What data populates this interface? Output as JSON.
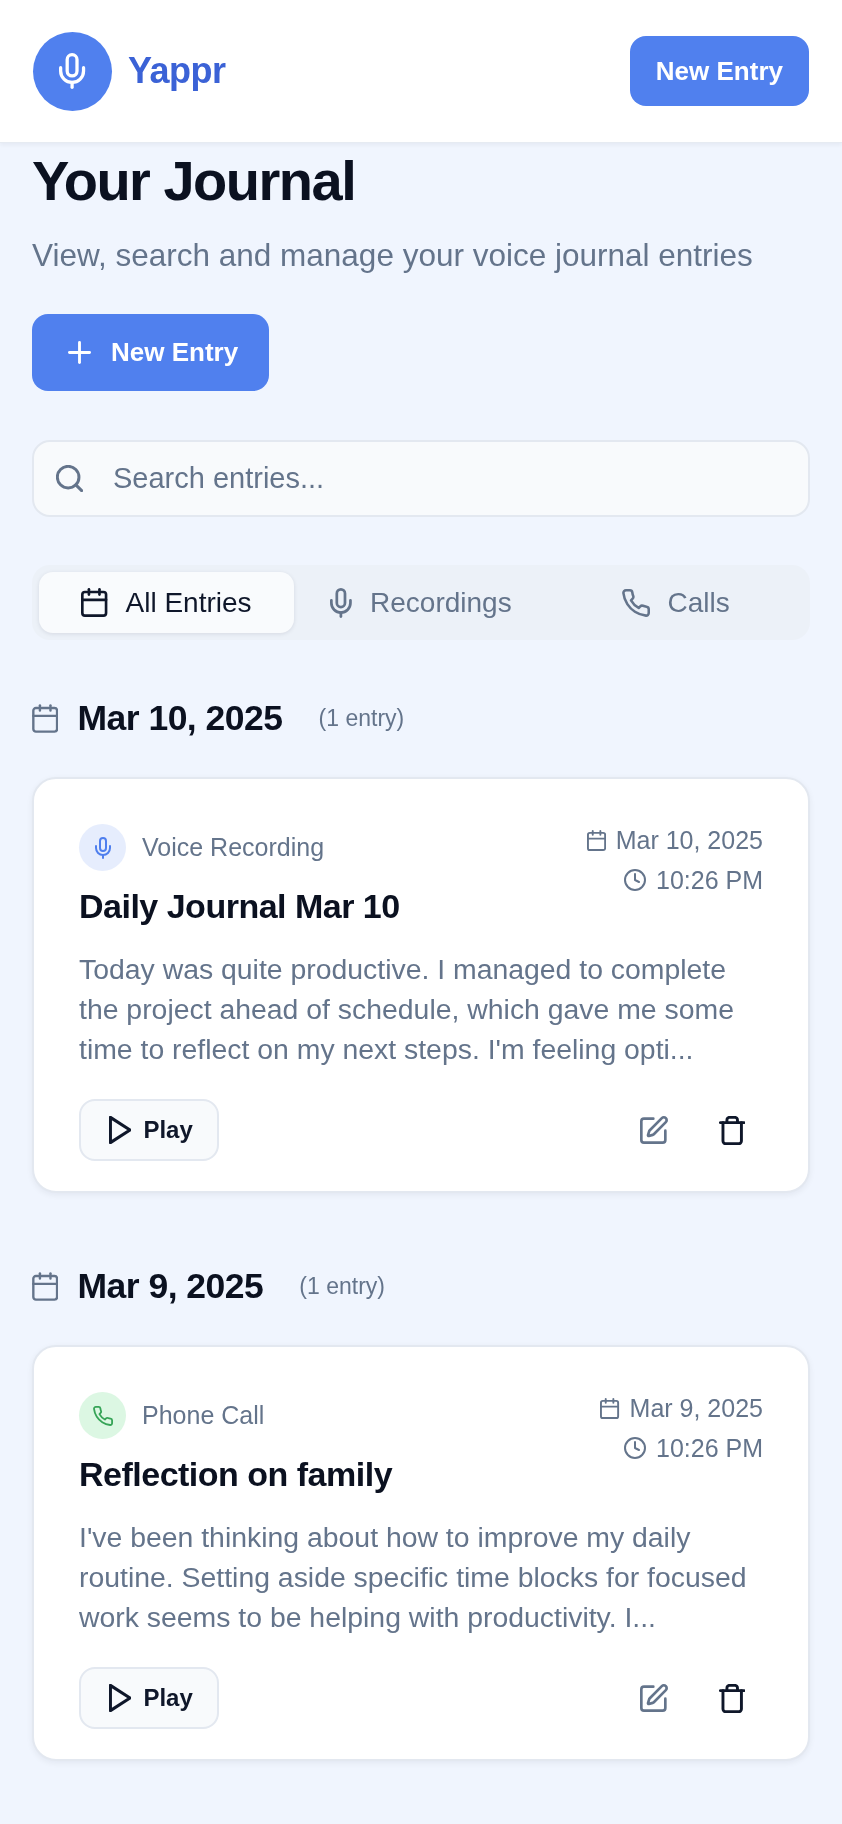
{
  "header": {
    "app_name": "Yappr",
    "button": "New Entry"
  },
  "intro": {
    "title": "Your Journal",
    "subtitle": "View, search and manage your voice journal entries",
    "button": "New Entry"
  },
  "search": {
    "placeholder": "Search entries..."
  },
  "tabs": [
    {
      "kind": "all",
      "label": "All Entries",
      "selected": true
    },
    {
      "kind": "recordings",
      "label": "Recordings",
      "selected": false
    },
    {
      "kind": "calls",
      "label": "Calls",
      "selected": false
    }
  ],
  "groups": [
    {
      "date": "Mar 10, 2025",
      "count": "(1 entry)",
      "entries": [
        {
          "kind": "recording",
          "type_label": "Voice Recording",
          "date": "Mar 10, 2025",
          "time": "10:26 PM",
          "title": "Daily Journal Mar 10",
          "excerpt": "Today was quite productive. I managed to complete the project ahead of schedule, which gave me some time to reflect on my next steps. I'm feeling opti...",
          "play_label": "Play"
        }
      ]
    },
    {
      "date": "Mar 9, 2025",
      "count": "(1 entry)",
      "entries": [
        {
          "kind": "call",
          "type_label": "Phone Call",
          "date": "Mar 9, 2025",
          "time": "10:26 PM",
          "title": "Reflection on family",
          "excerpt": "I've been thinking about how to improve my daily routine. Setting aside specific time blocks for focused work seems to be helping with productivity. I...",
          "play_label": "Play"
        }
      ]
    }
  ]
}
